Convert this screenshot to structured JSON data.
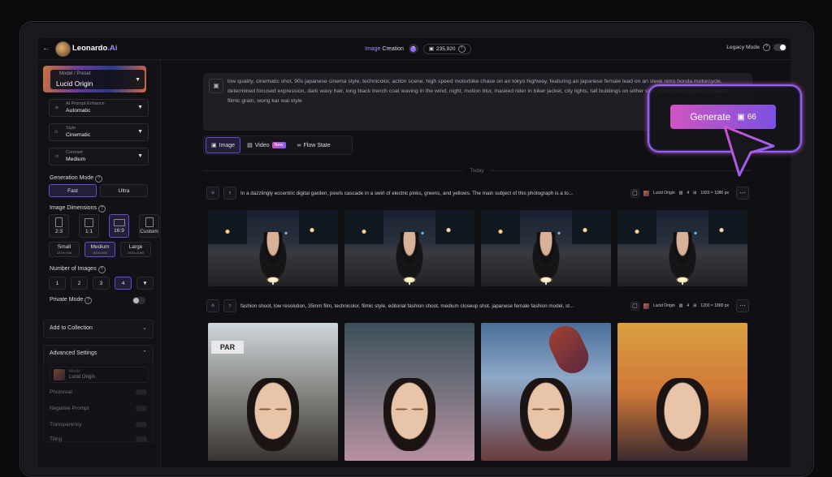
{
  "topbar": {
    "back_icon": "←",
    "brand_name": "Leonardo",
    "brand_suffix": ".Ai",
    "image_creation_hl": "Image",
    "image_creation_rest": " Creation",
    "tokens": "235,920",
    "legacy_mode": "Legacy Mode"
  },
  "sidebar": {
    "preset_label": "Model / Preset",
    "preset_value": "Lucid Origin",
    "prompt_enhance_label": "AI Prompt Enhance",
    "prompt_enhance_value": "Automatic",
    "style_label": "Style",
    "style_value": "Cinematic",
    "contrast_label": "Contrast",
    "contrast_value": "Medium",
    "generation_mode_title": "Generation Mode",
    "gen_modes": [
      "Fast",
      "Ultra"
    ],
    "image_dimensions_title": "Image Dimensions",
    "ratios": [
      "2:3",
      "1:1",
      "16:9",
      "Custom"
    ],
    "sizes": [
      {
        "label": "Small",
        "sub": "1376×768"
      },
      {
        "label": "Medium",
        "sub": "1600×896"
      },
      {
        "label": "Large",
        "sub": "1920×1080"
      }
    ],
    "number_of_images_title": "Number of Images",
    "counts": [
      "1",
      "2",
      "3",
      "4"
    ],
    "private_mode": "Private Mode",
    "add_to_collection": "Add to Collection",
    "advanced_settings": "Advanced Settings",
    "adv_model_label": "Model",
    "adv_model_value": "Lucid Origin",
    "adv_rows": [
      "Photoreal",
      "Negative Prompt",
      "Transparency",
      "Tiling"
    ]
  },
  "main": {
    "prompt_text": "low quality, cinematic shot, 90s japanese  cinema style, technicolor, action scene, high speed motorbike chase on an tokyo highway, featuring an japanese female lead on an sleek retro honda motorcycle, determined  focused expression, dark wavy hair, long black trench coat waving in the wind,  night, motion blur, masked rider in biker jacket, city lights, tall buildings on either side of the road, clipped highlights, filmic grain, wong kar wai style",
    "modes": [
      {
        "label": "Image",
        "icon": "▣"
      },
      {
        "label": "Video",
        "icon": "▤",
        "badge": "New"
      },
      {
        "label": "Flow State",
        "icon": "∞"
      }
    ],
    "today": "Today",
    "generations": [
      {
        "prompt": "In a dazzlingly eccentric digital garden, pixels cascade in a swirl of electric pinks, greens, and yellows. The main subject of this photograph is a to...",
        "model": "Lucid Origin",
        "count": "4",
        "size": "1920 × 1080 px"
      },
      {
        "prompt": "fashion shoot, low resolution, 35mm film, technicolor, filmic style, editorial fashion shoot, medium closeup shot, japanese female fashion model, st...",
        "model": "Lucid Origin",
        "count": "4",
        "size": "1200 × 1800 px"
      }
    ],
    "sign_text": "PAR"
  },
  "generate": {
    "label": "Generate",
    "cost": "66"
  }
}
